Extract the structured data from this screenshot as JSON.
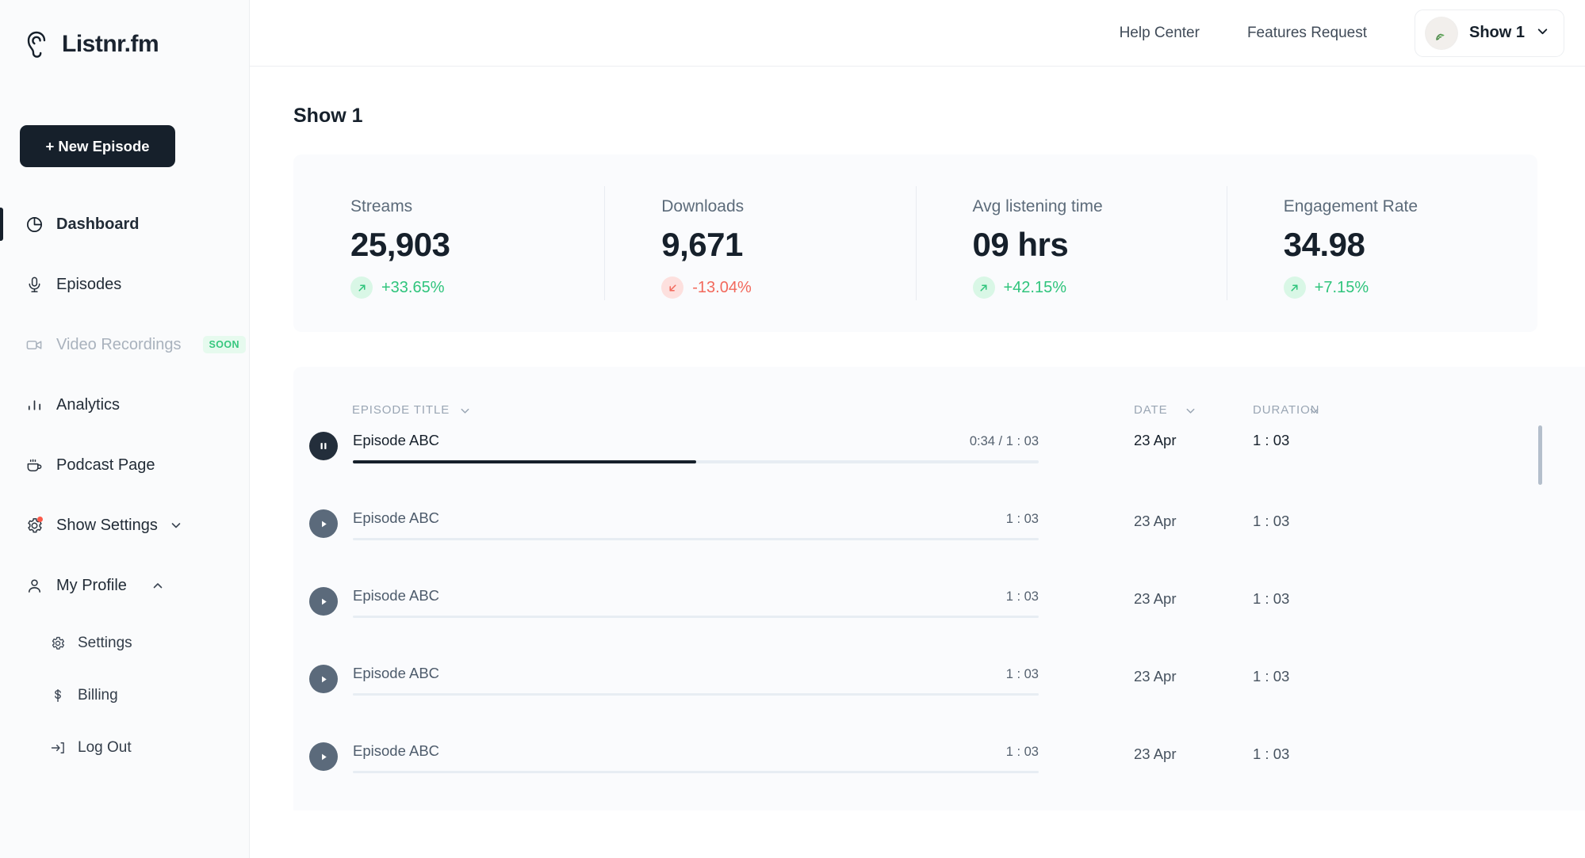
{
  "brand": {
    "name": "Listnr.fm",
    "logo_icon": "ear-icon"
  },
  "sidebar": {
    "new_episode_label": "+ New Episode",
    "items": [
      {
        "label": "Dashboard",
        "icon": "pie-chart-icon",
        "active": true
      },
      {
        "label": "Episodes",
        "icon": "microphone-icon",
        "active": false
      },
      {
        "label": "Video Recordings",
        "icon": "video-camera-icon",
        "badge": "SOON",
        "disabled": true
      },
      {
        "label": "Analytics",
        "icon": "bar-chart-icon",
        "active": false
      },
      {
        "label": "Podcast Page",
        "icon": "coffee-cup-icon",
        "active": false
      },
      {
        "label": "Show Settings",
        "icon": "gear-icon",
        "chevron": "chevron-down-icon",
        "notification": true
      },
      {
        "label": "My Profile",
        "icon": "person-icon",
        "chevron": "chevron-up-icon",
        "expanded": true
      }
    ],
    "profile_submenu": [
      {
        "label": "Settings",
        "icon": "gear-icon"
      },
      {
        "label": "Billing",
        "icon": "dollar-icon"
      },
      {
        "label": "Log Out",
        "icon": "logout-icon"
      }
    ]
  },
  "topbar": {
    "links": [
      {
        "label": "Help Center"
      },
      {
        "label": "Features Request"
      }
    ],
    "show_selector": {
      "name": "Show 1",
      "avatar_icon": "plant-avatar",
      "chevron": "chevron-down-icon"
    }
  },
  "page": {
    "title": "Show 1"
  },
  "stats": [
    {
      "label": "Streams",
      "value": "25,903",
      "delta": "+33.65%",
      "direction": "up",
      "icon": "arrow-up-right-icon"
    },
    {
      "label": "Downloads",
      "value": "9,671",
      "delta": "-13.04%",
      "direction": "down",
      "icon": "arrow-down-left-icon"
    },
    {
      "label": "Avg listening time",
      "value": "09 hrs",
      "delta": "+42.15%",
      "direction": "up",
      "icon": "arrow-up-right-icon"
    },
    {
      "label": "Engagement Rate",
      "value": "34.98",
      "delta": "+7.15%",
      "direction": "up",
      "icon": "arrow-up-right-icon"
    }
  ],
  "episodes_table": {
    "columns": [
      {
        "label": "EPISODE TITLE",
        "sort_icon": "chevron-down-icon"
      },
      {
        "label": "DATE",
        "sort_icon": "chevron-down-icon"
      },
      {
        "label": "DURATION",
        "sort_icon": "chevron-down-icon"
      }
    ],
    "rows": [
      {
        "title": "Episode ABC",
        "time": "0:34 / 1 : 03",
        "date": "23 Apr",
        "duration": "1 : 03",
        "playing": true,
        "progress": 50
      },
      {
        "title": "Episode ABC",
        "time": "1 : 03",
        "date": "23 Apr",
        "duration": "1 : 03",
        "playing": false,
        "progress": 0
      },
      {
        "title": "Episode ABC",
        "time": "1 : 03",
        "date": "23 Apr",
        "duration": "1 : 03",
        "playing": false,
        "progress": 0
      },
      {
        "title": "Episode ABC",
        "time": "1 : 03",
        "date": "23 Apr",
        "duration": "1 : 03",
        "playing": false,
        "progress": 0
      },
      {
        "title": "Episode ABC",
        "time": "1 : 03",
        "date": "23 Apr",
        "duration": "1 : 03",
        "playing": false,
        "progress": 0
      }
    ]
  },
  "colors": {
    "accent_dark": "#16202b",
    "positive": "#2fc47c",
    "negative": "#f2695c",
    "badge_soon_bg": "#e6faee",
    "badge_soon_text": "#36c77e",
    "panel_bg": "#fafbfd"
  }
}
